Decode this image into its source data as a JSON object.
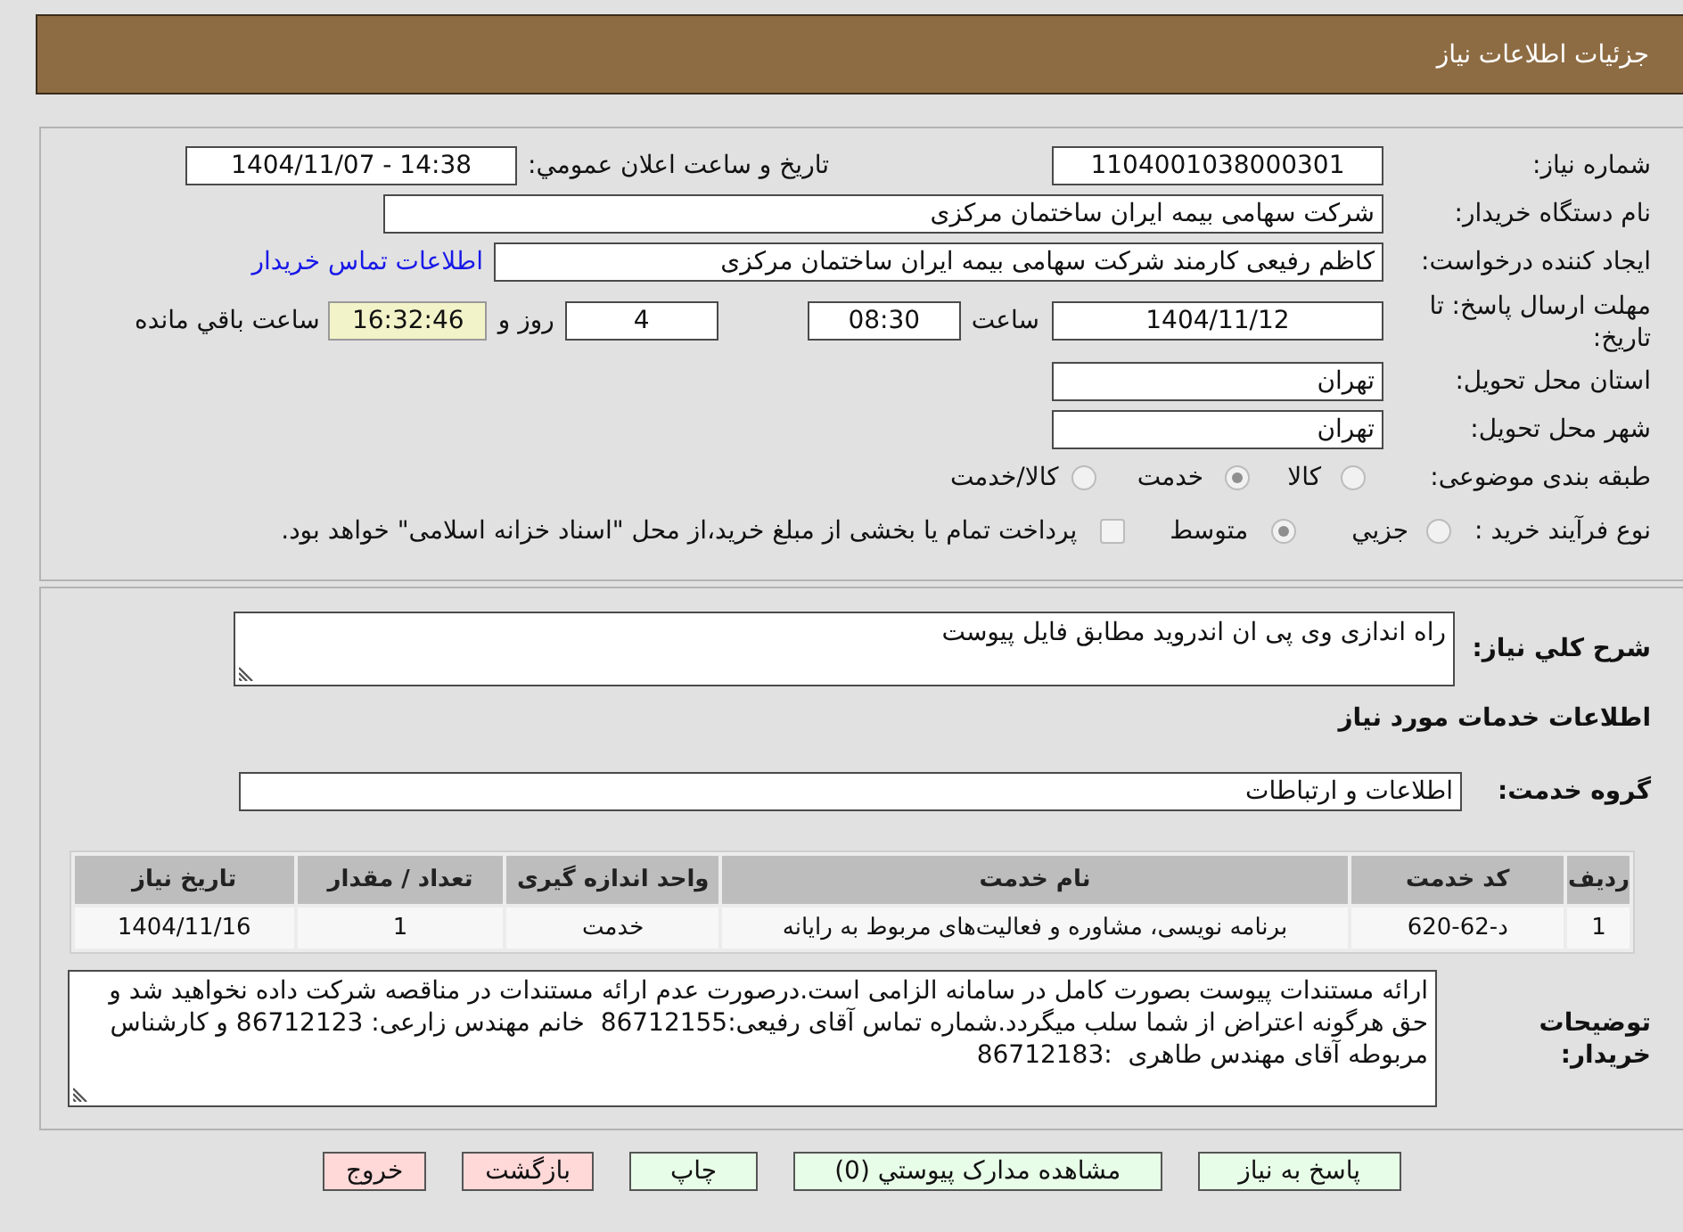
{
  "header": {
    "title": "جزئیات اطلاعات نیاز"
  },
  "need_details": {
    "need_number": {
      "label": "شماره نیاز:",
      "value": "1104001038000301"
    },
    "announcement": {
      "label": "تاریخ و ساعت اعلان عمومي:",
      "value": "1404/11/07 - 14:38"
    },
    "buyer_organization": {
      "label": "نام دستگاه خریدار:",
      "value": "شرکت سهامی بیمه ایران ساختمان مرکزی"
    },
    "requester": {
      "label": "ایجاد کننده درخواست:",
      "value": "کاظم رفیعی کارمند شرکت سهامی بیمه ایران ساختمان مرکزی",
      "contact_link": "اطلاعات تماس خریدار"
    },
    "deadline": {
      "label": "مهلت ارسال پاسخ: تا تاریخ:",
      "date": "1404/11/12",
      "time_label": "ساعت",
      "time": "08:30",
      "days": "4",
      "days_label": "روز و",
      "remaining_time": "16:32:46",
      "remaining_label": "ساعت باقي مانده"
    },
    "delivery_province": {
      "label": "استان محل تحویل:",
      "value": "تهران"
    },
    "delivery_city": {
      "label": "شهر محل تحویل:",
      "value": "تهران"
    },
    "category": {
      "label": "طبقه بندی موضوعی:",
      "options": [
        {
          "label": "کالا",
          "selected": false,
          "disabled": true
        },
        {
          "label": "خدمت",
          "selected": true,
          "disabled": true
        },
        {
          "label": "کالا/خدمت",
          "selected": false,
          "disabled": true
        }
      ]
    },
    "purchase_process": {
      "label": "نوع فرآیند خرید :",
      "options": [
        {
          "label": "جزيي",
          "selected": false,
          "disabled": true
        },
        {
          "label": "متوسط",
          "selected": true,
          "disabled": true
        }
      ],
      "treasury_option": {
        "label": "پرداخت تمام یا بخشی از مبلغ خرید،از محل \"اسناد خزانه اسلامی\" خواهد بود.",
        "checked": false,
        "disabled": true
      }
    }
  },
  "services": {
    "description": {
      "label": "شرح کلي نیاز:",
      "value": "راه اندازی وی پی ان اندروید مطابق فایل پیوست"
    },
    "section_title": "اطلاعات خدمات مورد نیاز",
    "service_group": {
      "label": "گروه خدمت:",
      "value": "اطلاعات و ارتباطات"
    },
    "table": {
      "columns": [
        "ردیف",
        "کد خدمت",
        "نام خدمت",
        "واحد اندازه گیری",
        "تعداد / مقدار",
        "تاریخ نیاز"
      ],
      "rows": [
        [
          "1",
          "د-62-620",
          "برنامه نویسی، مشاوره و فعالیت‌های مربوط به رایانه",
          "خدمت",
          "1",
          "1404/11/16"
        ]
      ]
    },
    "buyer_notes": {
      "label": "توضیحات خریدار:",
      "value": "ارائه مستندات پیوست بصورت کامل در سامانه الزامی است.درصورت عدم ارائه مستندات در مناقصه شرکت داده نخواهید شد و حق هرگونه اعتراض از شما سلب میگردد.شماره تماس آقای رفیعی:86712155  خانم مهندس زارعی: 86712123 و کارشناس مربوطه آقای مهندس طاهری  :86712183"
    }
  },
  "buttons": [
    {
      "label": "پاسخ به نیاز",
      "kind": "action"
    },
    {
      "label": "مشاهده مدارک پیوستي (0)",
      "kind": "action"
    },
    {
      "label": "چاپ",
      "kind": "action"
    },
    {
      "label": "بازگشت",
      "kind": "exit"
    },
    {
      "label": "خروج",
      "kind": "exit"
    }
  ]
}
